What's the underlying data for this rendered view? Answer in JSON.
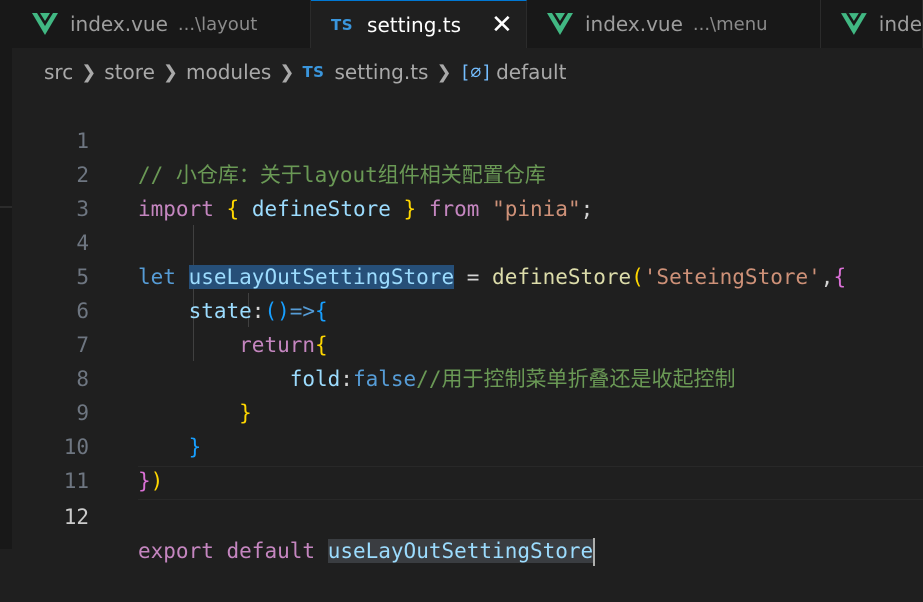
{
  "tabs": [
    {
      "name": "index.vue",
      "desc": "...\\layout",
      "icon": "vue-icon",
      "active": false
    },
    {
      "name": "setting.ts",
      "desc": "",
      "icon": "ts-icon",
      "active": true,
      "close": "✕"
    },
    {
      "name": "index.vue",
      "desc": "...\\menu",
      "icon": "vue-icon",
      "active": false
    },
    {
      "name": "inde",
      "desc": "",
      "icon": "vue-icon",
      "active": false
    }
  ],
  "ts_label": "TS",
  "breadcrumb": {
    "items": [
      "src",
      "store",
      "modules"
    ],
    "file": "setting.ts",
    "symbol_icon": "[⌀]",
    "symbol": "default"
  },
  "line_numbers": [
    "1",
    "2",
    "3",
    "4",
    "5",
    "6",
    "7",
    "8",
    "9",
    "10",
    "11",
    "12"
  ],
  "code": {
    "l1": "// 小仓库：关于layout组件相关配置仓库",
    "l2": {
      "import": "import",
      "lb": "{",
      "name": " defineStore ",
      "rb": "}",
      "from": "from",
      "str": "\"pinia\"",
      "semi": ";"
    },
    "l4": {
      "let": "let",
      "var": "useLayOutSettingStore",
      "eq": " = ",
      "fn": "defineStore",
      "lp": "(",
      "str": "'SeteingStore'",
      "comma": ",",
      "lb": "{"
    },
    "l5": {
      "key": "state",
      "colon": ":",
      "parens": "()",
      "arrow": "=>",
      "lb": "{"
    },
    "l6": {
      "ret": "return",
      "lb": "{"
    },
    "l7": {
      "key": "fold",
      "colon": ":",
      "val": "false",
      "comment": "//用于控制菜单折叠还是收起控制"
    },
    "l8": "}",
    "l9": "}",
    "l10": {
      "rb": "}",
      "rp": ")"
    },
    "l12": {
      "export": "export",
      "default": "default",
      "name": "useLayOutSettingStore"
    }
  }
}
